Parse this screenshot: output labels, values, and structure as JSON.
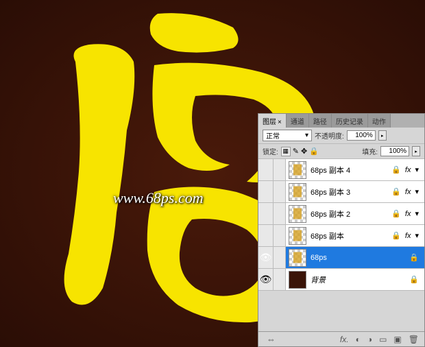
{
  "watermark": "www.68ps.com",
  "panel": {
    "tabs": [
      {
        "label": "图层",
        "active": true
      },
      {
        "label": "通道",
        "active": false
      },
      {
        "label": "路径",
        "active": false
      },
      {
        "label": "历史记录",
        "active": false
      },
      {
        "label": "动作",
        "active": false
      }
    ],
    "blend_mode": "正常",
    "opacity_label": "不透明度:",
    "opacity_value": "100%",
    "lock_label": "锁定:",
    "fill_label": "填充:",
    "fill_value": "100%",
    "layers": [
      {
        "name": "68ps 副本 4",
        "visible": false,
        "italic": false,
        "locked": true,
        "fx": true,
        "selected": false,
        "thumb": "fu"
      },
      {
        "name": "68ps 副本 3",
        "visible": false,
        "italic": false,
        "locked": true,
        "fx": true,
        "selected": false,
        "thumb": "fu"
      },
      {
        "name": "68ps 副本 2",
        "visible": false,
        "italic": false,
        "locked": true,
        "fx": true,
        "selected": false,
        "thumb": "fu"
      },
      {
        "name": "68ps 副本",
        "visible": false,
        "italic": false,
        "locked": true,
        "fx": true,
        "selected": false,
        "thumb": "fu"
      },
      {
        "name": "68ps",
        "visible": true,
        "italic": false,
        "locked": true,
        "fx": false,
        "selected": true,
        "thumb": "fu"
      },
      {
        "name": "背景",
        "visible": true,
        "italic": true,
        "locked": true,
        "fx": false,
        "selected": false,
        "thumb": "bg"
      }
    ]
  }
}
